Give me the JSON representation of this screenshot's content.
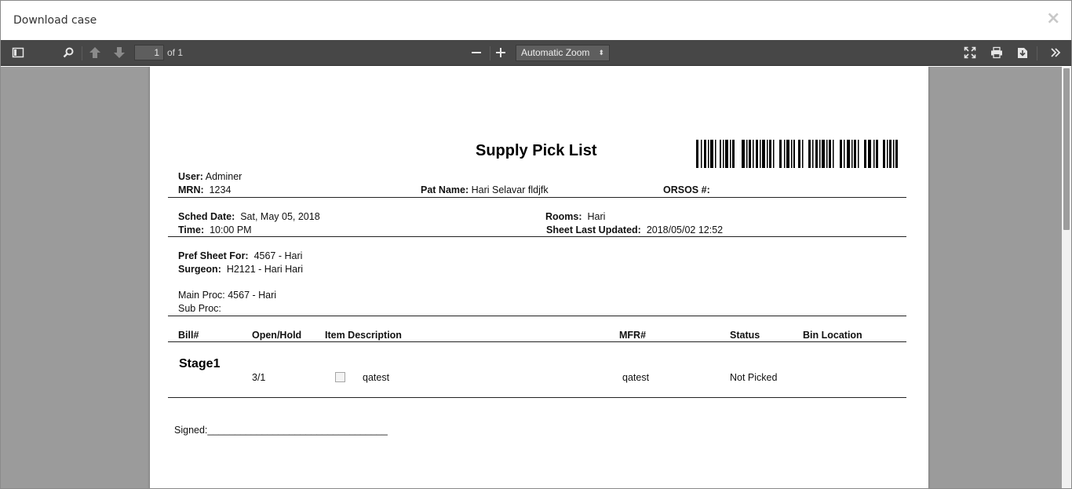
{
  "modal": {
    "title": "Download case",
    "close_icon": "close-icon"
  },
  "toolbar": {
    "sidebar_toggle_icon": "sidebar-toggle-icon",
    "find_icon": "search-icon",
    "prev_icon": "arrow-up-icon",
    "next_icon": "arrow-down-icon",
    "page_number": "1",
    "page_count": "of 1",
    "zoom_out_icon": "minus-icon",
    "zoom_in_icon": "plus-icon",
    "zoom_value": "Automatic Zoom",
    "presentation_icon": "fullscreen-icon",
    "print_icon": "print-icon",
    "download_icon": "download-icon",
    "tools_icon": "double-chevron-right-icon",
    "bg_color": "#474747"
  },
  "document": {
    "title": "Supply Pick List",
    "user_label": "User:",
    "user_value": "Adminer",
    "mrn_label": "MRN:",
    "mrn_value": "1234",
    "pat_name_label": "Pat Name:",
    "pat_name_value": "Hari Selavar fldjfk",
    "orsos_label": "ORSOS #:",
    "sched_date_label": "Sched Date:",
    "sched_date_value": "Sat, May 05, 2018",
    "rooms_label": "Rooms:",
    "rooms_value": "Hari",
    "time_label": "Time:",
    "time_value": "10:00 PM",
    "sheet_updated_label": "Sheet Last Updated:",
    "sheet_updated_value": "2018/05/02 12:52",
    "pref_sheet_label": "Pref Sheet For:",
    "pref_sheet_value": "4567 - Hari",
    "surgeon_label": "Surgeon:",
    "surgeon_value": "H2121 - Hari Hari",
    "main_proc": "Main Proc: 4567 - Hari",
    "sub_proc": "Sub Proc:",
    "columns": [
      "Bill#",
      "Open/Hold",
      "Item Description",
      "MFR#",
      "Status",
      "Bin Location"
    ],
    "stage_label": "Stage1",
    "row": {
      "open_hold": "3/1",
      "description": "qatest",
      "mfr": "qatest",
      "status": "Not Picked",
      "checked": false
    },
    "signed": "Signed:_________________________________"
  }
}
